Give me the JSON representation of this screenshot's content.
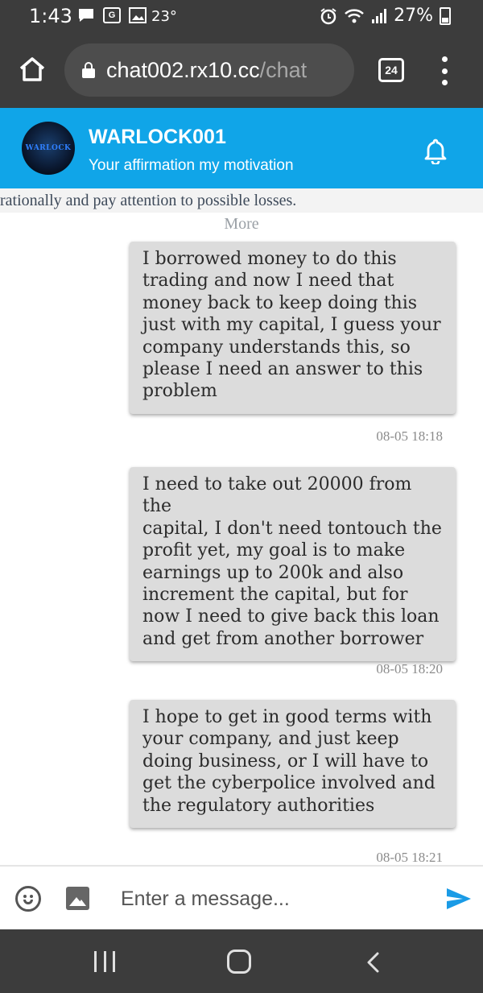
{
  "status_bar": {
    "time": "1:43",
    "temperature": "23°",
    "battery": "27%",
    "icons": [
      "chat-bubble-icon",
      "translate-icon",
      "gallery-icon",
      "alarm-icon",
      "wifi-icon",
      "signal-icon",
      "battery-icon"
    ]
  },
  "browser": {
    "url_host": "chat002.rx10.cc",
    "url_path": "/chat",
    "tab_count": "24"
  },
  "chat": {
    "avatar_text": "WARLOCK",
    "title": "WARLOCK001",
    "subtitle": "Your affirmation my motivation",
    "notice": "rationally and pay attention to possible losses.",
    "more_label": "More",
    "messages": [
      {
        "lines": [
          "I borrowed money to do this",
          "trading and now I need that",
          "money back to keep doing this",
          "just with my capital, I guess your",
          "company understands this, so",
          "please I need an answer to this",
          "problem"
        ],
        "time": "08-05 18:18"
      },
      {
        "lines": [
          "I need to take out 20000 from the",
          "capital, I don't need tontouch the",
          "profit yet, my goal is to make",
          "earnings up to 200k and also",
          "increment the capital, but for",
          "now I need to give back this loan",
          "and get from another borrower"
        ],
        "time": "08-05 18:20"
      },
      {
        "lines": [
          "I hope to get in good terms with",
          "your company, and just keep",
          "doing business, or I will have to",
          "get the cyberpolice involved and",
          "the regulatory authorities"
        ],
        "time": "08-05 18:21"
      }
    ]
  },
  "input": {
    "placeholder": "Enter a message..."
  },
  "colors": {
    "header": "#10a5e8",
    "system_bar": "#3c3c3c",
    "bubble": "#dcdcdc",
    "send": "#1a9be6"
  }
}
